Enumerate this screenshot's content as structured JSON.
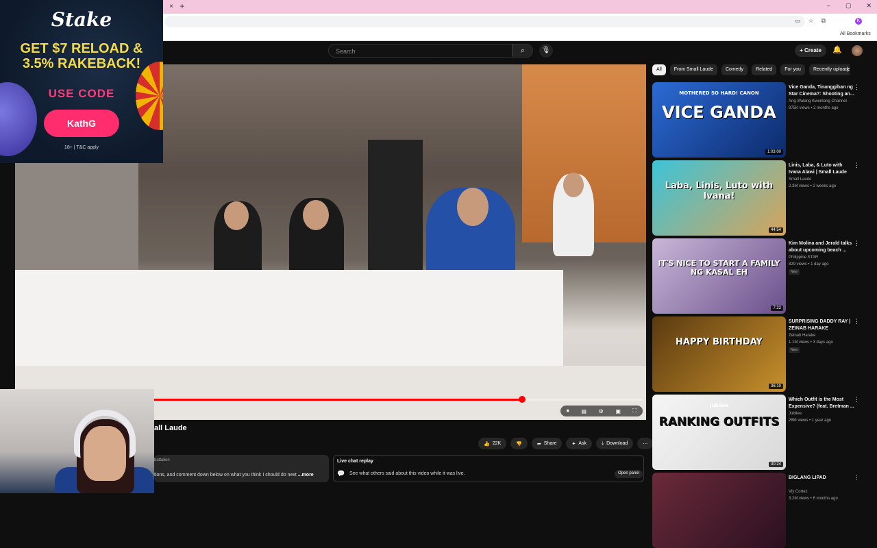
{
  "browser": {
    "tab_close": "×",
    "tab_new": "+",
    "window_controls": [
      "–",
      "▢",
      "✕"
    ],
    "profile_initial": "K",
    "bookmarks_label": "All Bookmarks"
  },
  "youtube": {
    "search_placeholder": "Search",
    "create_label": "Create"
  },
  "video": {
    "title_partial": "all Laude",
    "progress_fraction": 0.753,
    "actions": {
      "like_count": "22K",
      "share_label": "Share",
      "ask_label": "Ask",
      "download_label": "Download"
    },
    "description_user": "battalion",
    "description_text": "tions, and comment down below on what you think I should do next",
    "description_more": " ...more",
    "live_chat": {
      "title": "Live chat replay",
      "subtitle": "See what others said about this video while it was live.",
      "open_label": "Open panel"
    }
  },
  "chips": [
    "All",
    "From Small Laude",
    "Comedy",
    "Related",
    "For you",
    "Recently uploaded"
  ],
  "recommendations": [
    {
      "title": "Vice Ganda, Tinanggihan ng Star Cinema?: Shooting an...",
      "channel": "Ang Walang Kwentang Channel",
      "meta": "875K views • 2 months ago",
      "duration": "1:03:00",
      "badge": "",
      "thumb_text": "VICE GANDA",
      "thumb_sub": "MOTHERED SO HARD! CANON",
      "thumb_colors": [
        "#2b6bd6",
        "#0d2a6b"
      ]
    },
    {
      "title": "Linis, Laba, & Luto with Ivana Alawi | Small Laude",
      "channel": "Small Laude",
      "meta": "2.3M views • 2 weeks ago",
      "duration": "44:54",
      "badge": "",
      "thumb_text": "Laba, Linis, Luto with Ivana!",
      "thumb_sub": "",
      "thumb_colors": [
        "#3cc4d8",
        "#d8a35a"
      ]
    },
    {
      "title": "Kim Molina and Jerald talks about upcoming beach ...",
      "channel": "Philippine STAR",
      "meta": "829 views • 1 day ago",
      "duration": "7:22",
      "badge": "New",
      "thumb_text": "IT'S NICE TO START A FAMILY NG KASAL EH",
      "thumb_sub": "",
      "thumb_colors": [
        "#c9b7d8",
        "#6a4f8a"
      ]
    },
    {
      "title": "SURPRISING DADDY RAY | ZEINAB HARAKE",
      "channel": "Zeinab Harake",
      "meta": "1.1M views • 3 days ago",
      "duration": "36:10",
      "badge": "New",
      "thumb_text": "HAPPY BIRTHDAY",
      "thumb_sub": "",
      "thumb_colors": [
        "#5a3a10",
        "#c8902c"
      ]
    },
    {
      "title": "Which Outfit is the Most Expensive? (feat. Bretman ...",
      "channel": "Jubilee",
      "meta": "28M views • 1 year ago",
      "duration": "30:24",
      "badge": "",
      "thumb_text": "RANKING OUTFITS",
      "thumb_sub": "Jubilee",
      "thumb_colors": [
        "#f5f5f5",
        "#d8d8d8"
      ]
    },
    {
      "title": "BIGLANG LIPAD",
      "channel": "Viy Cortez",
      "meta": "3.2M views • 6 months ago",
      "duration": "",
      "badge": "",
      "thumb_text": "",
      "thumb_sub": "",
      "thumb_colors": [
        "#6b2a3a",
        "#2a1020"
      ]
    }
  ],
  "ad": {
    "logo": "Stake",
    "headline_1": "GET $7 RELOAD &",
    "headline_2": "3.5% RAKEBACK!",
    "code_label": "USE CODE",
    "code": "KathG",
    "terms": "18+ | T&C apply"
  }
}
